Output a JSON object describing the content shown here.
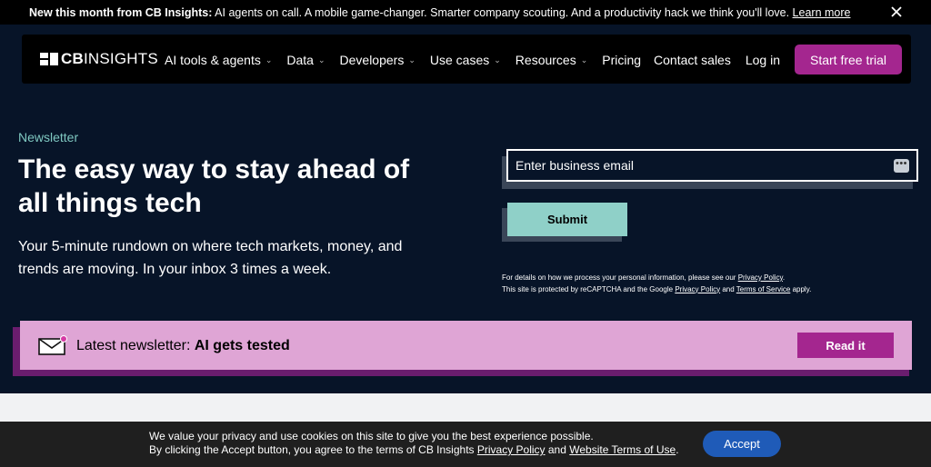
{
  "announcement": {
    "lead": "New this month from CB Insights:",
    "text": " AI agents on call. A mobile game-changer. Smarter company scouting. And a productivity hack we think you'll love. ",
    "link": "Learn more",
    "close_icon": "close-icon"
  },
  "nav": {
    "logo_cb": "CB",
    "logo_insights": "INSIGHTS",
    "menu": [
      {
        "label": "AI tools & agents",
        "dropdown": true
      },
      {
        "label": "Data",
        "dropdown": true
      },
      {
        "label": "Developers",
        "dropdown": true
      },
      {
        "label": "Use cases",
        "dropdown": true
      },
      {
        "label": "Resources",
        "dropdown": true
      },
      {
        "label": "Pricing",
        "dropdown": false
      }
    ],
    "contact_sales": "Contact sales",
    "log_in": "Log in",
    "start_trial": "Start free trial"
  },
  "hero": {
    "eyebrow": "Newsletter",
    "title": "The easy way to stay ahead of all things tech",
    "subtitle": "Your 5-minute rundown on where tech markets, money, and trends are moving. In your inbox 3 times a week."
  },
  "form": {
    "email_placeholder": "Enter business email",
    "submit": "Submit",
    "legal_line1_pre": "For details on how we process your personal information, please see our ",
    "legal_line1_link": "Privacy Policy",
    "legal_line1_post": ".",
    "legal_line2_pre": "This site is protected by reCAPTCHA and the Google ",
    "legal_line2_link1": "Privacy Policy",
    "legal_line2_mid": " and ",
    "legal_line2_link2": "Terms of Service",
    "legal_line2_post": " apply."
  },
  "banner": {
    "lead": "Latest newsletter: ",
    "title": "AI gets tested",
    "button": "Read it"
  },
  "cookie": {
    "line1": "We value your privacy and use cookies on this site to give you the best experience possible.",
    "line2_pre": "By clicking the Accept button, you agree to the terms of CB Insights ",
    "link1": "Privacy Policy",
    "and": " and ",
    "link2": "Website Terms of Use",
    "post": ".",
    "accept": "Accept"
  },
  "colors": {
    "background": "#071428",
    "accent_magenta": "#a4268f",
    "accent_teal": "#8fd0c8",
    "banner_pink": "#dfa5d5",
    "accept_blue": "#1f5bb8"
  }
}
